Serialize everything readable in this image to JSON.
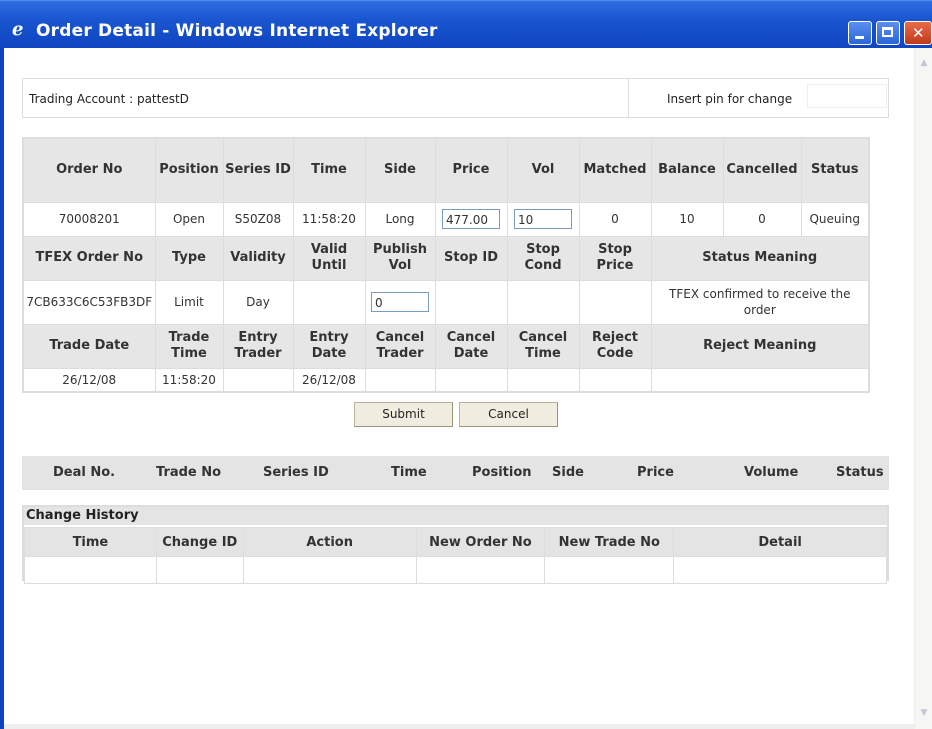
{
  "window": {
    "title": "Order Detail - Windows Internet Explorer",
    "icon": "ie-icon"
  },
  "account": {
    "label": "Trading Account : pattestD",
    "pin_label": "Insert pin for change",
    "pin_value": ""
  },
  "grid": {
    "row1_headers": [
      "Order No",
      "Position",
      "Series ID",
      "Time",
      "Side",
      "Price",
      "Vol",
      "Matched",
      "Balance",
      "Cancelled",
      "Status"
    ],
    "row1_values": [
      "70008201",
      "Open",
      "S50Z08",
      "11:58:20",
      "Long",
      "477.00",
      "10",
      "0",
      "10",
      "0",
      "Queuing"
    ],
    "row2_headers": [
      "TFEX Order No",
      "Type",
      "Validity",
      "Valid Until",
      "Publish Vol",
      "Stop ID",
      "Stop Cond",
      "Stop Price",
      "Status Meaning"
    ],
    "row2_values": [
      "7CB633C6C53FB3DF",
      "Limit",
      "Day",
      "",
      "0",
      "",
      "",
      "",
      "TFEX confirmed to receive the order"
    ],
    "row3_headers": [
      "Trade Date",
      "Trade Time",
      "Entry Trader",
      "Entry Date",
      "Cancel Trader",
      "Cancel Date",
      "Cancel Time",
      "Reject Code",
      "Reject Meaning"
    ],
    "row3_values": [
      "26/12/08",
      "11:58:20",
      "",
      "26/12/08",
      "",
      "",
      "",
      "",
      ""
    ]
  },
  "buttons": {
    "submit": "Submit",
    "cancel": "Cancel"
  },
  "deals": {
    "headers": [
      "Deal No.",
      "Trade No",
      "Series ID",
      "Time",
      "Position",
      "Side",
      "Price",
      "Volume",
      "Status"
    ]
  },
  "history": {
    "title": "Change History",
    "headers": [
      "Time",
      "Change ID",
      "Action",
      "New Order No",
      "New Trade No",
      "Detail"
    ]
  }
}
